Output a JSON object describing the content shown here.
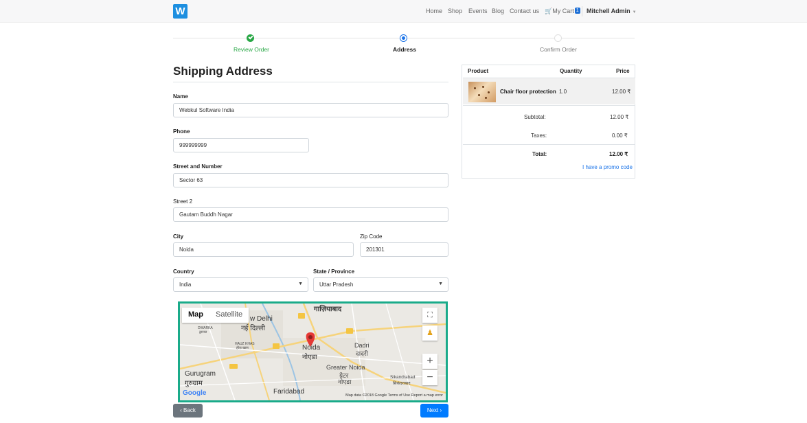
{
  "header": {
    "nav": [
      "Home",
      "Shop",
      "Events",
      "Blog",
      "Contact us"
    ],
    "cart_label": "My Cart",
    "cart_count": "1",
    "user": "Mitchell Admin"
  },
  "wizard": {
    "steps": [
      {
        "label": "Review Order",
        "state": "done"
      },
      {
        "label": "Address",
        "state": "active"
      },
      {
        "label": "Confirm Order",
        "state": "todo"
      }
    ]
  },
  "form": {
    "title": "Shipping Address",
    "name_label": "Name",
    "name_value": "Webkul Software India",
    "phone_label": "Phone",
    "phone_value": "999999999",
    "street_label": "Street and Number",
    "street_value": "Sector 63",
    "street2_label": "Street 2",
    "street2_value": "Gautam Buddh Nagar",
    "city_label": "City",
    "city_value": "Noida",
    "zip_label": "Zip Code",
    "zip_value": "201301",
    "country_label": "Country",
    "country_value": "India",
    "state_label": "State / Province",
    "state_value": "Uttar Pradesh"
  },
  "map": {
    "type_map": "Map",
    "type_satellite": "Satellite",
    "places": {
      "ghaziabad": "गाज़ियाबाद",
      "new_delhi": "w Delhi",
      "new_delhi_hi": "नई दिल्ली",
      "dwarka": "DWARKA",
      "dwarka_hi": "द्वारका",
      "hauz_khas": "HAUZ KHAS",
      "hauz_khas_hi": "हौज़ खास",
      "noida": "Noida",
      "noida_hi": "नोएडा",
      "dadri": "Dadri",
      "dadri_hi": "दादरी",
      "greater_noida": "Greater Noida",
      "greater_noida_hi": "ग्रेटर",
      "greater_noida_hi2": "नोएडा",
      "gurugram": "Gurugram",
      "gurugram_hi": "गुरुग्राम",
      "faridabad": "Faridabad",
      "sikandrabad": "Sikandrabad",
      "sikandrabad_hi": "सिकंदराबाद"
    },
    "google": "Google",
    "footer": "Map data ©2018 Google   Terms of Use   Report a map error"
  },
  "buttons": {
    "back": "‹ Back",
    "next": "Next ›"
  },
  "summary": {
    "col_product": "Product",
    "col_quantity": "Quantity",
    "col_price": "Price",
    "product_name": "Chair floor protection",
    "product_qty": "1.0",
    "product_price": "12.00 ₹",
    "subtotal_label": "Subtotal:",
    "subtotal_value": "12.00 ₹",
    "taxes_label": "Taxes:",
    "taxes_value": "0.00 ₹",
    "total_label": "Total:",
    "total_value": "12.00 ₹",
    "promo": "I have a promo code"
  }
}
